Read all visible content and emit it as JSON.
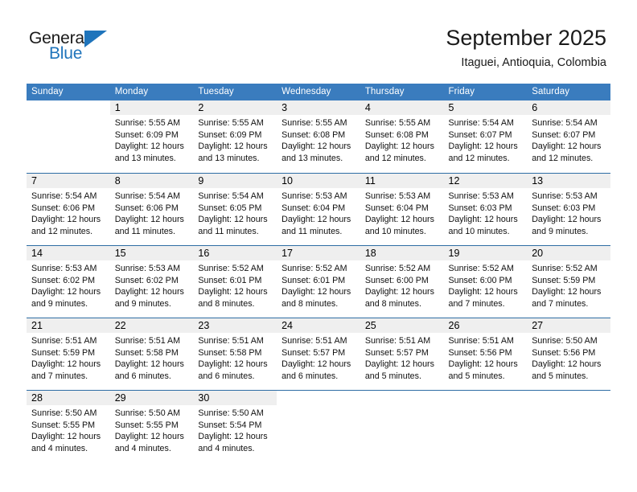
{
  "brand": {
    "name_top": "General",
    "name_bottom": "Blue",
    "accent_color": "#1f74bb"
  },
  "header": {
    "title": "September 2025",
    "location": "Itaguei, Antioquia, Colombia"
  },
  "calendar": {
    "header_bg": "#3a7cbe",
    "row_divider_color": "#2e6da4",
    "daynum_band_color": "#efefef",
    "weekdays": [
      "Sunday",
      "Monday",
      "Tuesday",
      "Wednesday",
      "Thursday",
      "Friday",
      "Saturday"
    ],
    "weeks": [
      [
        {
          "day": "",
          "lines": []
        },
        {
          "day": "1",
          "lines": [
            "Sunrise: 5:55 AM",
            "Sunset: 6:09 PM",
            "Daylight: 12 hours",
            "and 13 minutes."
          ]
        },
        {
          "day": "2",
          "lines": [
            "Sunrise: 5:55 AM",
            "Sunset: 6:09 PM",
            "Daylight: 12 hours",
            "and 13 minutes."
          ]
        },
        {
          "day": "3",
          "lines": [
            "Sunrise: 5:55 AM",
            "Sunset: 6:08 PM",
            "Daylight: 12 hours",
            "and 13 minutes."
          ]
        },
        {
          "day": "4",
          "lines": [
            "Sunrise: 5:55 AM",
            "Sunset: 6:08 PM",
            "Daylight: 12 hours",
            "and 12 minutes."
          ]
        },
        {
          "day": "5",
          "lines": [
            "Sunrise: 5:54 AM",
            "Sunset: 6:07 PM",
            "Daylight: 12 hours",
            "and 12 minutes."
          ]
        },
        {
          "day": "6",
          "lines": [
            "Sunrise: 5:54 AM",
            "Sunset: 6:07 PM",
            "Daylight: 12 hours",
            "and 12 minutes."
          ]
        }
      ],
      [
        {
          "day": "7",
          "lines": [
            "Sunrise: 5:54 AM",
            "Sunset: 6:06 PM",
            "Daylight: 12 hours",
            "and 12 minutes."
          ]
        },
        {
          "day": "8",
          "lines": [
            "Sunrise: 5:54 AM",
            "Sunset: 6:06 PM",
            "Daylight: 12 hours",
            "and 11 minutes."
          ]
        },
        {
          "day": "9",
          "lines": [
            "Sunrise: 5:54 AM",
            "Sunset: 6:05 PM",
            "Daylight: 12 hours",
            "and 11 minutes."
          ]
        },
        {
          "day": "10",
          "lines": [
            "Sunrise: 5:53 AM",
            "Sunset: 6:04 PM",
            "Daylight: 12 hours",
            "and 11 minutes."
          ]
        },
        {
          "day": "11",
          "lines": [
            "Sunrise: 5:53 AM",
            "Sunset: 6:04 PM",
            "Daylight: 12 hours",
            "and 10 minutes."
          ]
        },
        {
          "day": "12",
          "lines": [
            "Sunrise: 5:53 AM",
            "Sunset: 6:03 PM",
            "Daylight: 12 hours",
            "and 10 minutes."
          ]
        },
        {
          "day": "13",
          "lines": [
            "Sunrise: 5:53 AM",
            "Sunset: 6:03 PM",
            "Daylight: 12 hours",
            "and 9 minutes."
          ]
        }
      ],
      [
        {
          "day": "14",
          "lines": [
            "Sunrise: 5:53 AM",
            "Sunset: 6:02 PM",
            "Daylight: 12 hours",
            "and 9 minutes."
          ]
        },
        {
          "day": "15",
          "lines": [
            "Sunrise: 5:53 AM",
            "Sunset: 6:02 PM",
            "Daylight: 12 hours",
            "and 9 minutes."
          ]
        },
        {
          "day": "16",
          "lines": [
            "Sunrise: 5:52 AM",
            "Sunset: 6:01 PM",
            "Daylight: 12 hours",
            "and 8 minutes."
          ]
        },
        {
          "day": "17",
          "lines": [
            "Sunrise: 5:52 AM",
            "Sunset: 6:01 PM",
            "Daylight: 12 hours",
            "and 8 minutes."
          ]
        },
        {
          "day": "18",
          "lines": [
            "Sunrise: 5:52 AM",
            "Sunset: 6:00 PM",
            "Daylight: 12 hours",
            "and 8 minutes."
          ]
        },
        {
          "day": "19",
          "lines": [
            "Sunrise: 5:52 AM",
            "Sunset: 6:00 PM",
            "Daylight: 12 hours",
            "and 7 minutes."
          ]
        },
        {
          "day": "20",
          "lines": [
            "Sunrise: 5:52 AM",
            "Sunset: 5:59 PM",
            "Daylight: 12 hours",
            "and 7 minutes."
          ]
        }
      ],
      [
        {
          "day": "21",
          "lines": [
            "Sunrise: 5:51 AM",
            "Sunset: 5:59 PM",
            "Daylight: 12 hours",
            "and 7 minutes."
          ]
        },
        {
          "day": "22",
          "lines": [
            "Sunrise: 5:51 AM",
            "Sunset: 5:58 PM",
            "Daylight: 12 hours",
            "and 6 minutes."
          ]
        },
        {
          "day": "23",
          "lines": [
            "Sunrise: 5:51 AM",
            "Sunset: 5:58 PM",
            "Daylight: 12 hours",
            "and 6 minutes."
          ]
        },
        {
          "day": "24",
          "lines": [
            "Sunrise: 5:51 AM",
            "Sunset: 5:57 PM",
            "Daylight: 12 hours",
            "and 6 minutes."
          ]
        },
        {
          "day": "25",
          "lines": [
            "Sunrise: 5:51 AM",
            "Sunset: 5:57 PM",
            "Daylight: 12 hours",
            "and 5 minutes."
          ]
        },
        {
          "day": "26",
          "lines": [
            "Sunrise: 5:51 AM",
            "Sunset: 5:56 PM",
            "Daylight: 12 hours",
            "and 5 minutes."
          ]
        },
        {
          "day": "27",
          "lines": [
            "Sunrise: 5:50 AM",
            "Sunset: 5:56 PM",
            "Daylight: 12 hours",
            "and 5 minutes."
          ]
        }
      ],
      [
        {
          "day": "28",
          "lines": [
            "Sunrise: 5:50 AM",
            "Sunset: 5:55 PM",
            "Daylight: 12 hours",
            "and 4 minutes."
          ]
        },
        {
          "day": "29",
          "lines": [
            "Sunrise: 5:50 AM",
            "Sunset: 5:55 PM",
            "Daylight: 12 hours",
            "and 4 minutes."
          ]
        },
        {
          "day": "30",
          "lines": [
            "Sunrise: 5:50 AM",
            "Sunset: 5:54 PM",
            "Daylight: 12 hours",
            "and 4 minutes."
          ]
        },
        {
          "day": "",
          "lines": []
        },
        {
          "day": "",
          "lines": []
        },
        {
          "day": "",
          "lines": []
        },
        {
          "day": "",
          "lines": []
        }
      ]
    ]
  }
}
